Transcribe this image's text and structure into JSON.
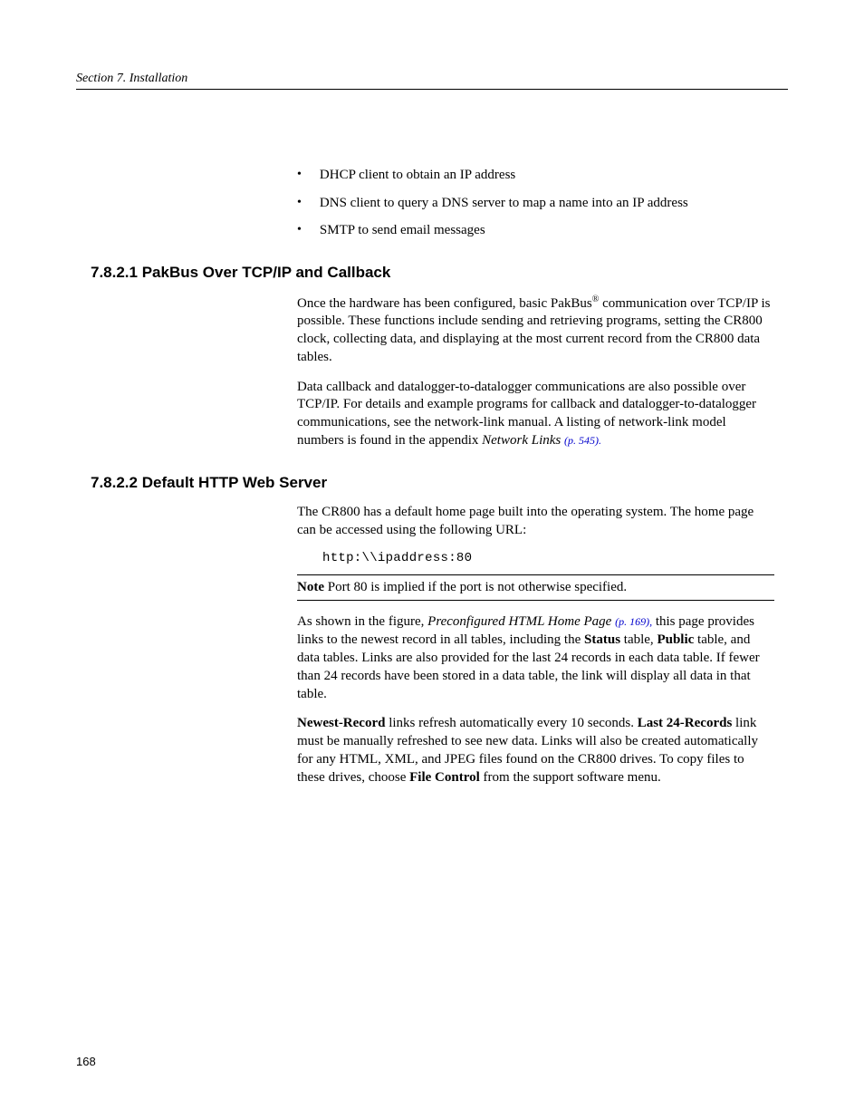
{
  "header": "Section 7.  Installation",
  "bullets": [
    "DHCP client to obtain an IP address",
    "DNS client to query a DNS server to map a name into an IP address",
    "SMTP to send email messages"
  ],
  "section1": {
    "heading": "7.8.2.1 PakBus Over TCP/IP and Callback",
    "p1_a": "Once the hardware has been configured, basic PakBus",
    "p1_sup": "®",
    "p1_b": " communication over TCP/IP is possible. These functions include sending and retrieving programs, setting the CR800 clock, collecting data, and displaying at the most current record from the CR800 data tables.",
    "p2_a": "Data callback and datalogger-to-datalogger communications are also possible over TCP/IP.  For details and example programs for callback and datalogger-to-datalogger communications, see the network-link manual. A listing of network-link model numbers is found in the appendix ",
    "p2_italic": "Network Links ",
    "p2_link": "(p. 545).",
    "p2_end": ""
  },
  "section2": {
    "heading": "7.8.2.2 Default HTTP Web Server",
    "p1": "The CR800 has a default home page built into the operating system.  The home page can be accessed using the following URL:",
    "code": "http:\\\\ipaddress:80",
    "note_bold": "Note",
    "note_text": "  Port 80 is implied if the port is not otherwise specified.",
    "p2_a": "As shown in the figure, ",
    "p2_italic": "Preconfigured HTML Home Page ",
    "p2_link": "(p. 169),",
    "p2_b": " this page provides links to the newest record in all tables, including the ",
    "p2_bold1": "Status",
    "p2_c": " table, ",
    "p2_bold2": "Public",
    "p2_d": " table, and data tables. Links are also provided for the last 24 records in each data table. If fewer than 24 records have been stored in a data table, the link will display all data in that table.",
    "p3_bold1": "Newest-Record",
    "p3_a": " links refresh automatically every 10 seconds. ",
    "p3_bold2": "Last 24-Records",
    "p3_b": " link must be manually refreshed to see new data.  Links will also be created automatically for any HTML, XML, and JPEG files found on the CR800 drives. To copy files to these drives, choose ",
    "p3_bold3": "File Control",
    "p3_c": " from the support software menu."
  },
  "pageNumber": "168"
}
